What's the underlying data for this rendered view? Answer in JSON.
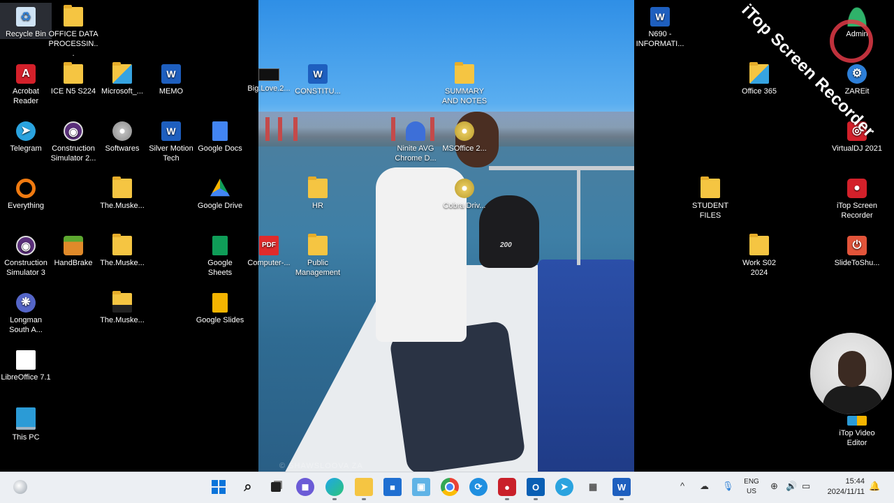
{
  "desktop_icons": {
    "recycle_bin": "Recycle Bin",
    "office_data": "OFFICE DATA PROCESSIN...",
    "acrobat": "Acrobat Reader",
    "ice_n5": "ICE N5 S224",
    "microsoft": "Microsoft_...",
    "memo": "MEMO",
    "telegram": "Telegram",
    "construction_sim2": "Construction Simulator 2...",
    "softwares": "Softwares",
    "silver_motion": "Silver Motion Tech",
    "google_docs": "Google Docs",
    "everything": "Everything",
    "muske1": "The.Muske...",
    "google_drive": "Google Drive",
    "construction_sim3": "Construction Simulator 3",
    "handbrake": "HandBrake",
    "muske2": "The.Muske...",
    "google_sheets": "Google Sheets",
    "longman": "Longman South A...",
    "muske3": "The.Muske...",
    "google_slides": "Google Slides",
    "libreoffice": "LibreOffice 7.1",
    "this_pc": "This PC",
    "big_love": "Big.Love.2...",
    "constitu": "CONSTITU...",
    "summary": "SUMMARY AND NOTES",
    "ninite": "Ninite AVG Chrome D...",
    "msoffice": "MSOffice 2...",
    "hr": "HR",
    "cobra": "Cobra Driv...",
    "computer_pdf": "Computer-...",
    "public_mgmt": "Public Management",
    "n690": "N690 - INFORMATI...",
    "admin": "Admin",
    "office365": "Office 365",
    "anydesk": "ZAREit",
    "virtualdj": "VirtualDJ 2021",
    "student_files": "STUDENT FILES",
    "itop_recorder": "iTop Screen Recorder",
    "work_s02": "Work S02 2024",
    "slidetoshu": "SlideToShu...",
    "itop_video": "iTop Video Editor"
  },
  "watermark": "iTop Screen Recorder",
  "wallpaper": {
    "motor_brand": "200",
    "caption": "© SHAWSLOOVA ZA"
  },
  "taskbar": {
    "lang_top": "ENG",
    "lang_bottom": "US",
    "time": "15:44",
    "date": "2024/11/11"
  },
  "colors": {
    "folder": "#f5c542",
    "word": "#1e5fbf",
    "taskbar_bg": "#eceff3",
    "recorder_red": "#e13a46"
  }
}
